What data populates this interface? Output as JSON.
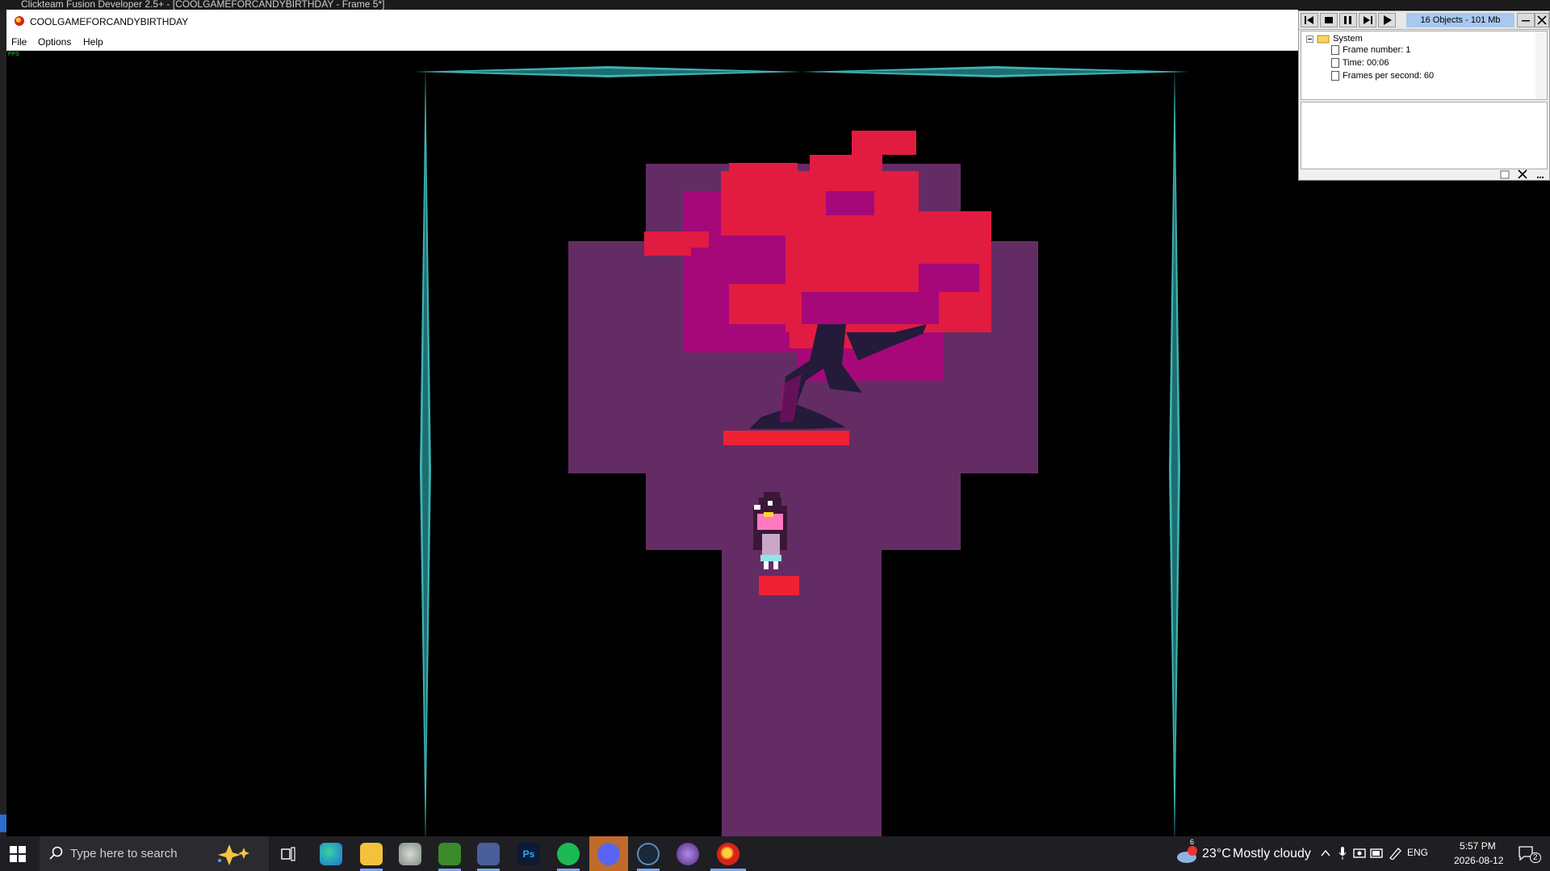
{
  "background_window": {
    "title": "Clickteam Fusion Developer 2.5+ - [COOLGAMEFORCANDYBIRTHDAY - Frame 5*]"
  },
  "app": {
    "title": "COOLGAMEFORCANDYBIRTHDAY",
    "menu": [
      "File",
      "Options",
      "Help"
    ],
    "fps_label": "FPS"
  },
  "debugger": {
    "status": "16 Objects - 101 Mb",
    "tree": {
      "root": "System",
      "items": [
        "Frame number: 1",
        "Time: 00:06",
        "Frames per second: 60"
      ]
    }
  },
  "taskbar": {
    "search_placeholder": "Type here to search",
    "pinned_icons": [
      "copilot-icon",
      "task-view-icon",
      "edge-icon",
      "file-explorer-icon",
      "app-icon",
      "minecraft-icon",
      "app-icon",
      "photoshop-icon",
      "spotify-icon",
      "discord-icon",
      "steam-icon",
      "app-icon",
      "clickteam-icon"
    ],
    "photoshop_label": "Ps",
    "weather": {
      "temp": "23°C",
      "condition": "Mostly cloudy",
      "badge": "6"
    },
    "lang": "ENG",
    "time": "5:57 PM",
    "date": "2026-08-12",
    "notifications": "2"
  },
  "colors": {
    "floor": "#642c64",
    "leaf_red": "#e11c40",
    "leaf_magenta": "#a6087a",
    "trunk": "#241a3a",
    "save_point": "#ee2233",
    "crystal": "#3fb3b3"
  }
}
